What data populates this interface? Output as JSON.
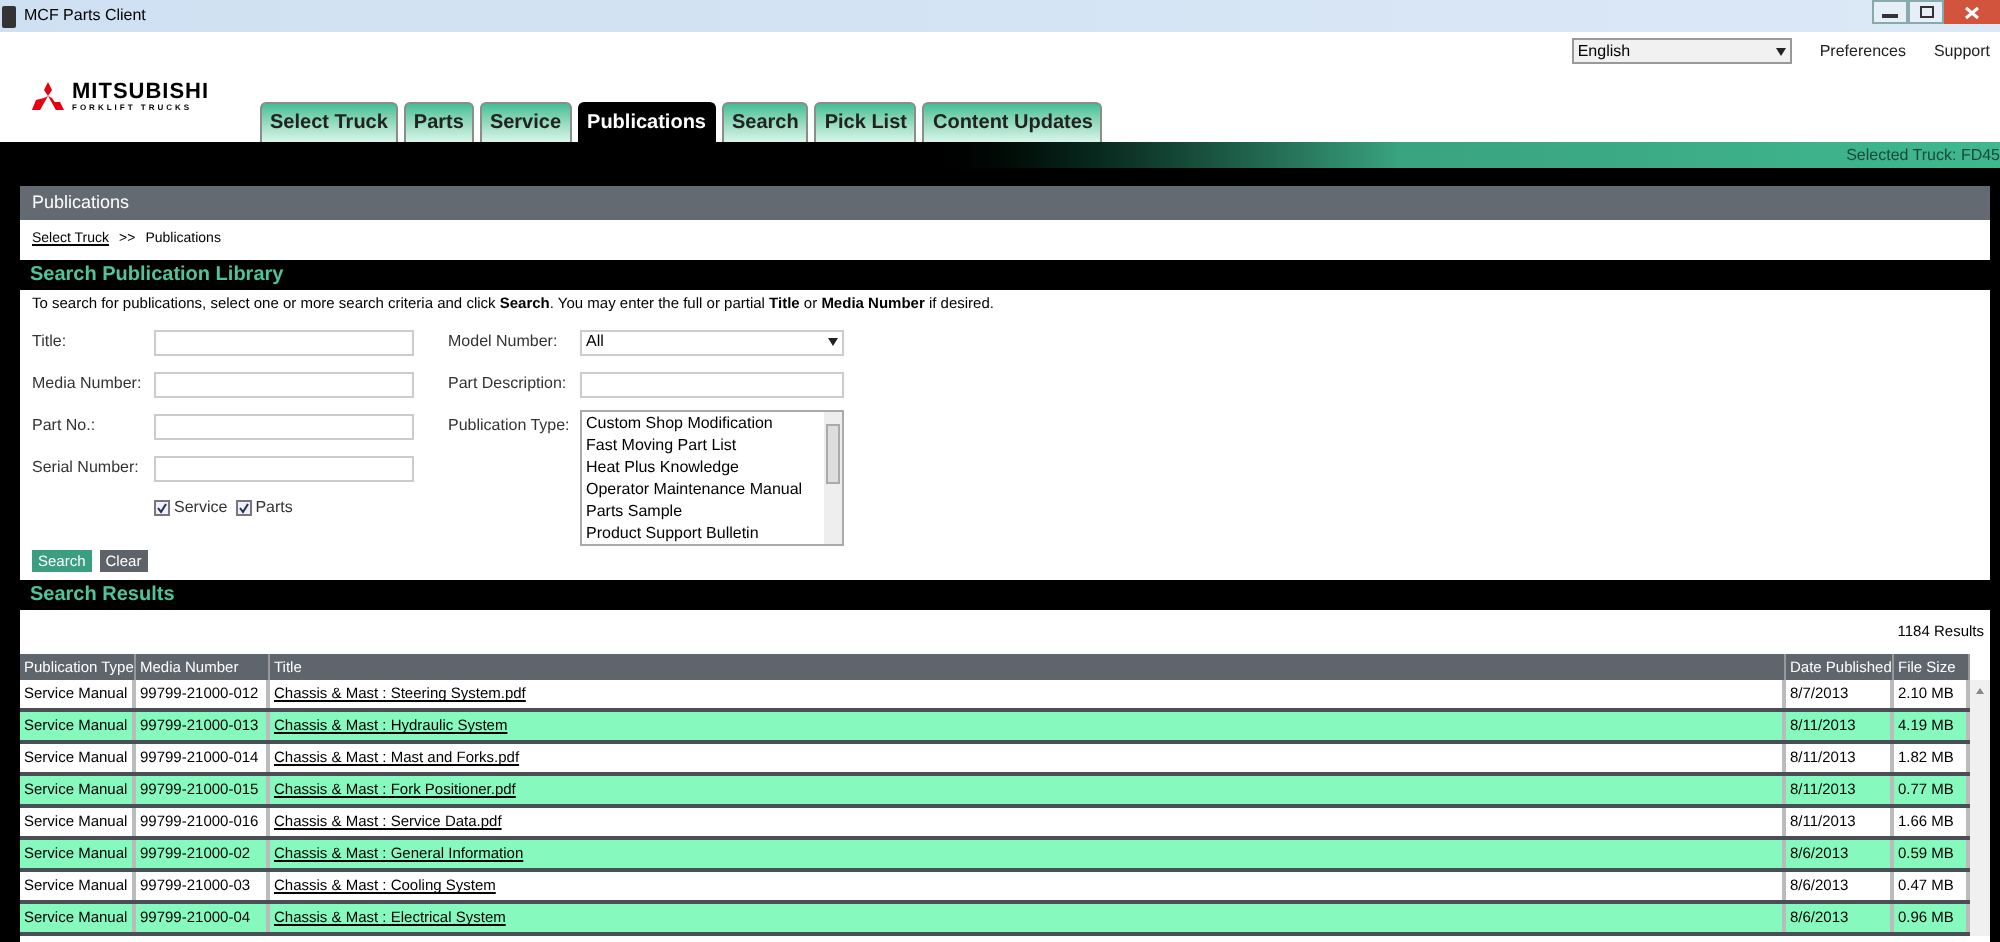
{
  "window": {
    "title": "MCF Parts Client"
  },
  "logo": {
    "name": "MITSUBISHI",
    "tagline": "FORKLIFT TRUCKS"
  },
  "language": {
    "value": "English"
  },
  "top_links": [
    "Preferences",
    "Support"
  ],
  "tabs": [
    {
      "label": "Select Truck",
      "selected": false
    },
    {
      "label": "Parts",
      "selected": false
    },
    {
      "label": "Service",
      "selected": false
    },
    {
      "label": "Publications",
      "selected": true
    },
    {
      "label": "Search",
      "selected": false
    },
    {
      "label": "Pick List",
      "selected": false
    },
    {
      "label": "Content Updates",
      "selected": false
    }
  ],
  "selected_truck": "Selected Truck: FD45",
  "page_title": "Publications",
  "breadcrumb": {
    "link": "Select Truck",
    "separator": ">>",
    "current": "Publications"
  },
  "search_section": {
    "title": "Search Publication Library",
    "intro": "To search for publications, select one or more search criteria and click **Search**. You may enter the full or partial **Title** or **Media Number** if desired.",
    "left_fields": [
      {
        "label": "Title:"
      },
      {
        "label": "Media Number:"
      },
      {
        "label": "Part No.:"
      },
      {
        "label": "Serial Number:"
      }
    ],
    "model_number": {
      "label": "Model Number:",
      "value": "All"
    },
    "part_description": {
      "label": "Part Description:"
    },
    "publication_type": {
      "label": "Publication Type:",
      "options": [
        "Custom Shop Modification",
        "Fast Moving Part List",
        "Heat Plus Knowledge",
        "Operator Maintenance Manual",
        "Parts Sample",
        "Product Support Bulletin"
      ]
    },
    "checkboxes": [
      {
        "label": "Service",
        "checked": true
      },
      {
        "label": "Parts",
        "checked": true
      }
    ],
    "buttons": [
      {
        "label": "Search",
        "kind": "primary"
      },
      {
        "label": "Clear",
        "kind": "secondary"
      }
    ]
  },
  "results": {
    "title": "Search Results",
    "count": "1184 Results",
    "columns": [
      "Publication Type",
      "Media Number",
      "Title",
      "Date Published",
      "File Size"
    ],
    "rows": [
      {
        "type": "Service Manual",
        "media": "99799-21000-012",
        "title": "Chassis & Mast : Steering System.pdf",
        "date": "8/7/2013",
        "size": "2.10 MB"
      },
      {
        "type": "Service Manual",
        "media": "99799-21000-013",
        "title": "Chassis & Mast : Hydraulic System",
        "date": "8/11/2013",
        "size": "4.19 MB"
      },
      {
        "type": "Service Manual",
        "media": "99799-21000-014",
        "title": "Chassis & Mast : Mast and Forks.pdf",
        "date": "8/11/2013",
        "size": "1.82 MB"
      },
      {
        "type": "Service Manual",
        "media": "99799-21000-015",
        "title": "Chassis & Mast : Fork Positioner.pdf",
        "date": "8/11/2013",
        "size": "0.77 MB"
      },
      {
        "type": "Service Manual",
        "media": "99799-21000-016",
        "title": "Chassis & Mast : Service Data.pdf",
        "date": "8/11/2013",
        "size": "1.66 MB"
      },
      {
        "type": "Service Manual",
        "media": "99799-21000-02",
        "title": "Chassis & Mast : General Information",
        "date": "8/6/2013",
        "size": "0.59 MB"
      },
      {
        "type": "Service Manual",
        "media": "99799-21000-03",
        "title": "Chassis & Mast : Cooling System",
        "date": "8/6/2013",
        "size": "0.47 MB"
      },
      {
        "type": "Service Manual",
        "media": "99799-21000-04",
        "title": "Chassis & Mast : Electrical System",
        "date": "8/6/2013",
        "size": "0.96 MB"
      }
    ]
  }
}
